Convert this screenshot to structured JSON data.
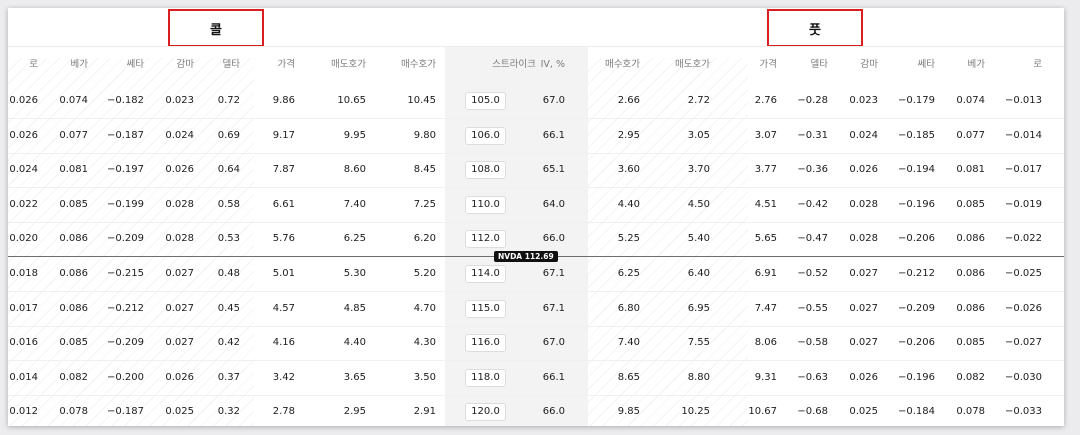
{
  "titles": {
    "calls": "콜",
    "puts": "풋"
  },
  "headers": {
    "call": [
      "로",
      "베가",
      "쎄타",
      "감마",
      "델타",
      "가격",
      "매도호가",
      "매수호가"
    ],
    "strike": "스트라이크",
    "iv": "IV, %",
    "put": [
      "매수호가",
      "매도호가",
      "가격",
      "델타",
      "감마",
      "쎄타",
      "베가",
      "로"
    ]
  },
  "underlying": {
    "label": "NVDA 112.69",
    "price": 112.69
  },
  "rows": [
    {
      "call": [
        "0.026",
        "0.074",
        "−0.182",
        "0.023",
        "0.72",
        "9.86",
        "10.65",
        "10.45"
      ],
      "strike": "105.0",
      "iv": "67.0",
      "put": [
        "2.66",
        "2.72",
        "2.76",
        "−0.28",
        "0.023",
        "−0.179",
        "0.074",
        "−0.013"
      ]
    },
    {
      "call": [
        "0.026",
        "0.077",
        "−0.187",
        "0.024",
        "0.69",
        "9.17",
        "9.95",
        "9.80"
      ],
      "strike": "106.0",
      "iv": "66.1",
      "put": [
        "2.95",
        "3.05",
        "3.07",
        "−0.31",
        "0.024",
        "−0.185",
        "0.077",
        "−0.014"
      ]
    },
    {
      "call": [
        "0.024",
        "0.081",
        "−0.197",
        "0.026",
        "0.64",
        "7.87",
        "8.60",
        "8.45"
      ],
      "strike": "108.0",
      "iv": "65.1",
      "put": [
        "3.60",
        "3.70",
        "3.77",
        "−0.36",
        "0.026",
        "−0.194",
        "0.081",
        "−0.017"
      ]
    },
    {
      "call": [
        "0.022",
        "0.085",
        "−0.199",
        "0.028",
        "0.58",
        "6.61",
        "7.40",
        "7.25"
      ],
      "strike": "110.0",
      "iv": "64.0",
      "put": [
        "4.40",
        "4.50",
        "4.51",
        "−0.42",
        "0.028",
        "−0.196",
        "0.085",
        "−0.019"
      ]
    },
    {
      "call": [
        "0.020",
        "0.086",
        "−0.209",
        "0.028",
        "0.53",
        "5.76",
        "6.25",
        "6.20"
      ],
      "strike": "112.0",
      "iv": "66.0",
      "put": [
        "5.25",
        "5.40",
        "5.65",
        "−0.47",
        "0.028",
        "−0.206",
        "0.086",
        "−0.022"
      ]
    },
    {
      "call": [
        "0.018",
        "0.086",
        "−0.215",
        "0.027",
        "0.48",
        "5.01",
        "5.30",
        "5.20"
      ],
      "strike": "114.0",
      "iv": "67.1",
      "put": [
        "6.25",
        "6.40",
        "6.91",
        "−0.52",
        "0.027",
        "−0.212",
        "0.086",
        "−0.025"
      ]
    },
    {
      "call": [
        "0.017",
        "0.086",
        "−0.212",
        "0.027",
        "0.45",
        "4.57",
        "4.85",
        "4.70"
      ],
      "strike": "115.0",
      "iv": "67.1",
      "put": [
        "6.80",
        "6.95",
        "7.47",
        "−0.55",
        "0.027",
        "−0.209",
        "0.086",
        "−0.026"
      ]
    },
    {
      "call": [
        "0.016",
        "0.085",
        "−0.209",
        "0.027",
        "0.42",
        "4.16",
        "4.40",
        "4.30"
      ],
      "strike": "116.0",
      "iv": "67.0",
      "put": [
        "7.40",
        "7.55",
        "8.06",
        "−0.58",
        "0.027",
        "−0.206",
        "0.085",
        "−0.027"
      ]
    },
    {
      "call": [
        "0.014",
        "0.082",
        "−0.200",
        "0.026",
        "0.37",
        "3.42",
        "3.65",
        "3.50"
      ],
      "strike": "118.0",
      "iv": "66.1",
      "put": [
        "8.65",
        "8.80",
        "9.31",
        "−0.63",
        "0.026",
        "−0.196",
        "0.082",
        "−0.030"
      ]
    },
    {
      "call": [
        "0.012",
        "0.078",
        "−0.187",
        "0.025",
        "0.32",
        "2.78",
        "2.95",
        "2.91"
      ],
      "strike": "120.0",
      "iv": "66.0",
      "put": [
        "9.85",
        "10.25",
        "10.67",
        "−0.68",
        "0.025",
        "−0.184",
        "0.078",
        "−0.033"
      ]
    }
  ]
}
